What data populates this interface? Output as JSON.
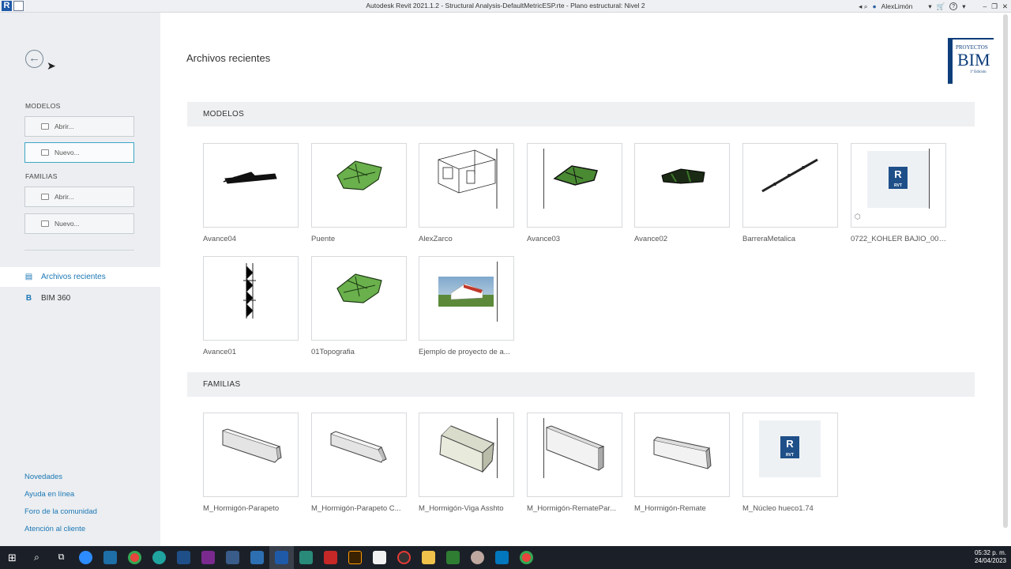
{
  "window": {
    "title": "Autodesk Revit 2021.1.2 - Structural Analysis-DefaultMetricESP.rte - Plano estructural: Nivel 2",
    "user": "AlexLimón",
    "help": "?"
  },
  "sidebar": {
    "modelos_heading": "MODELOS",
    "familias_heading": "FAMILIAS",
    "modelos_abrir": "Abrir...",
    "modelos_nuevo": "Nuevo...",
    "familias_abrir": "Abrir...",
    "familias_nuevo": "Nuevo...",
    "nav": [
      {
        "label": "Archivos recientes",
        "icon": "recent-files-icon",
        "active": true
      },
      {
        "label": "BIM 360",
        "icon": "bim360-icon",
        "active": false
      }
    ],
    "links": [
      "Novedades",
      "Ayuda en línea",
      "Foro de la comunidad",
      "Atención al cliente"
    ]
  },
  "main": {
    "title": "Archivos recientes",
    "logo": {
      "line1": "PROYECTOS",
      "line2": "BIM",
      "line3": "1ª Edición"
    },
    "modelos_section": "MODELOS",
    "familias_section": "FAMILIAS",
    "models": [
      {
        "name": "Avance04",
        "thumb": "bridge-wire"
      },
      {
        "name": "Puente",
        "thumb": "terrain-green"
      },
      {
        "name": "AlexZarco",
        "thumb": "house-wire"
      },
      {
        "name": "Avance03",
        "thumb": "terrain-green-line"
      },
      {
        "name": "Avance02",
        "thumb": "terrain-dark"
      },
      {
        "name": "BarreraMetalica",
        "thumb": "barrier"
      },
      {
        "name": "0722_KOHLER BAJIO_001...",
        "thumb": "rvt"
      },
      {
        "name": "Avance01",
        "thumb": "tower"
      },
      {
        "name": "01Topografia",
        "thumb": "terrain-green"
      },
      {
        "name": "Ejemplo de proyecto de a...",
        "thumb": "render"
      }
    ],
    "families": [
      {
        "name": "M_Hormigón-Parapeto",
        "thumb": "beam-a"
      },
      {
        "name": "M_Hormigón-Parapeto C...",
        "thumb": "beam-b"
      },
      {
        "name": "M_Hormigón-Viga Asshto",
        "thumb": "beam-c"
      },
      {
        "name": "M_Hormigón-RematePar...",
        "thumb": "beam-d"
      },
      {
        "name": "M_Hormigón-Remate",
        "thumb": "beam-e"
      },
      {
        "name": "M_Núcleo hueco1.74",
        "thumb": "rvt"
      }
    ]
  },
  "taskbar": {
    "time": "05:32 p. m.",
    "date": "24/04/2023"
  }
}
